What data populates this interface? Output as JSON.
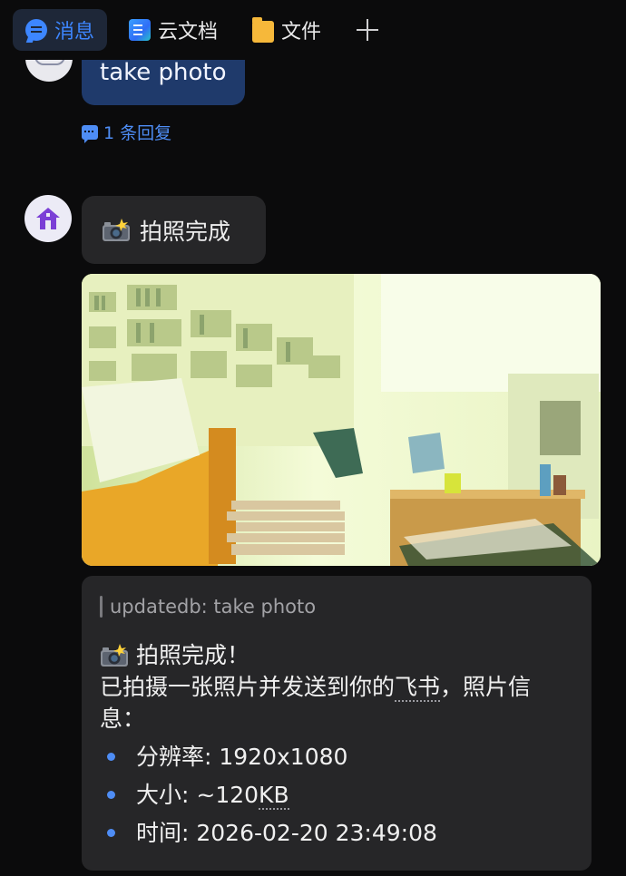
{
  "tabs": [
    {
      "label": "消息",
      "icon": "chat-icon",
      "active": true
    },
    {
      "label": "云文档",
      "icon": "doc-icon",
      "active": false
    },
    {
      "label": "文件",
      "icon": "folder-icon",
      "active": false
    }
  ],
  "user_message": {
    "text": "take photo"
  },
  "reply_link": {
    "text": "1 条回复"
  },
  "bot_message": {
    "text": "拍照完成",
    "photo_alt": "living room photo"
  },
  "card": {
    "quote": "updatedb: take photo",
    "title": "拍照完成！",
    "desc_pre": "已拍摄一张照片并发送到你的",
    "desc_link": "飞书",
    "desc_post": "，照片信息：",
    "items": [
      {
        "label": "分辨率: ",
        "value": "1920x1080",
        "value_suffix": ""
      },
      {
        "label": "大小: ",
        "value": "~120",
        "value_suffix": "KB"
      },
      {
        "label": "时间: ",
        "value": "2026-02-20 23:49:08",
        "value_suffix": ""
      }
    ]
  },
  "colors": {
    "accent": "#3d86ff",
    "background": "#0b0b0c",
    "bubble_user": "#1f3a6b",
    "bubble_bot": "#262628"
  }
}
